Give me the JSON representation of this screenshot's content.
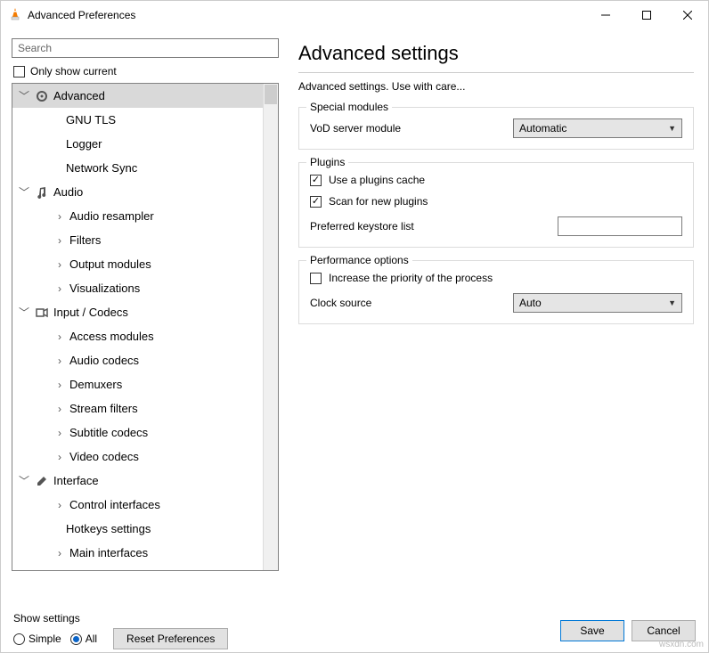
{
  "window": {
    "title": "Advanced Preferences"
  },
  "search": {
    "placeholder": "Search"
  },
  "only_show_current": "Only show current",
  "tree": {
    "advanced": "Advanced",
    "gnu_tls": "GNU TLS",
    "logger": "Logger",
    "network_sync": "Network Sync",
    "audio": "Audio",
    "audio_resampler": "Audio resampler",
    "filters": "Filters",
    "output_modules": "Output modules",
    "visualizations": "Visualizations",
    "input_codecs": "Input / Codecs",
    "access_modules": "Access modules",
    "audio_codecs": "Audio codecs",
    "demuxers": "Demuxers",
    "stream_filters": "Stream filters",
    "subtitle_codecs": "Subtitle codecs",
    "video_codecs": "Video codecs",
    "interface": "Interface",
    "control_interfaces": "Control interfaces",
    "hotkeys_settings": "Hotkeys settings",
    "main_interfaces": "Main interfaces"
  },
  "panel": {
    "heading": "Advanced settings",
    "subtext": "Advanced settings. Use with care...",
    "group_special": "Special modules",
    "vod_label": "VoD server module",
    "vod_value": "Automatic",
    "group_plugins": "Plugins",
    "use_plugins_cache": "Use a plugins cache",
    "scan_new_plugins": "Scan for new plugins",
    "preferred_keystore": "Preferred keystore list",
    "keystore_value": "",
    "group_perf": "Performance options",
    "increase_priority": "Increase the priority of the process",
    "clock_source": "Clock source",
    "clock_value": "Auto"
  },
  "footer": {
    "show_settings": "Show settings",
    "simple": "Simple",
    "all": "All",
    "reset": "Reset Preferences",
    "save": "Save",
    "cancel": "Cancel"
  },
  "watermark": "wsxdn.com"
}
